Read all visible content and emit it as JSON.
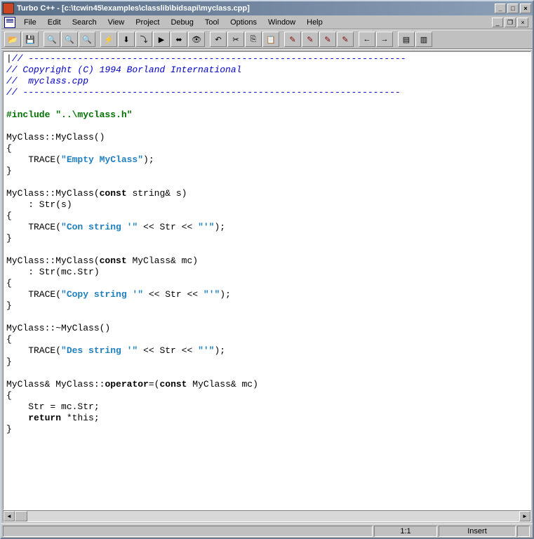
{
  "title": "Turbo C++ - [c:\\tcwin45\\examples\\classlib\\bidsapi\\myclass.cpp]",
  "menu": {
    "file": "File",
    "edit": "Edit",
    "search": "Search",
    "view": "View",
    "project": "Project",
    "debug": "Debug",
    "tool": "Tool",
    "options": "Options",
    "window": "Window",
    "help": "Help"
  },
  "code": {
    "dash1": "// ---------------------------------------------------------------------",
    "copy": "// Copyright (C) 1994 Borland International",
    "file": "//  myclass.cpp",
    "dash2": "// ---------------------------------------------------------------------",
    "incA": "#include ",
    "incB": "\"..\\myclass.h\"",
    "ctor1A": "MyClass::MyClass()",
    "ob": "{",
    "cb": "}",
    "trace": "    TRACE(",
    "s_empty": "\"Empty MyClass\"",
    "endp": ");",
    "ctor2A": "MyClass::MyClass(",
    "kw_const": "const",
    "ctor2B": " string& s)",
    "init1": "    : Str(s)",
    "s_con": "\"Con string '\"",
    "midop": " << Str << ",
    "s_tail": "\"'\"",
    "ctor3B": " MyClass& mc)",
    "init2": "    : Str(mc.Str)",
    "s_copy": "\"Copy string '\"",
    "dtorA": "MyClass::~MyClass()",
    "s_des": "\"Des string '\"",
    "opA": "MyClass& MyClass::",
    "kw_op": "operator",
    "opB": "=(",
    "assign": "    Str = mc.Str;",
    "ret": "    ",
    "kw_ret": "return",
    "retB": " *this;"
  },
  "status": {
    "pos": "1:1",
    "mode": "Insert"
  }
}
